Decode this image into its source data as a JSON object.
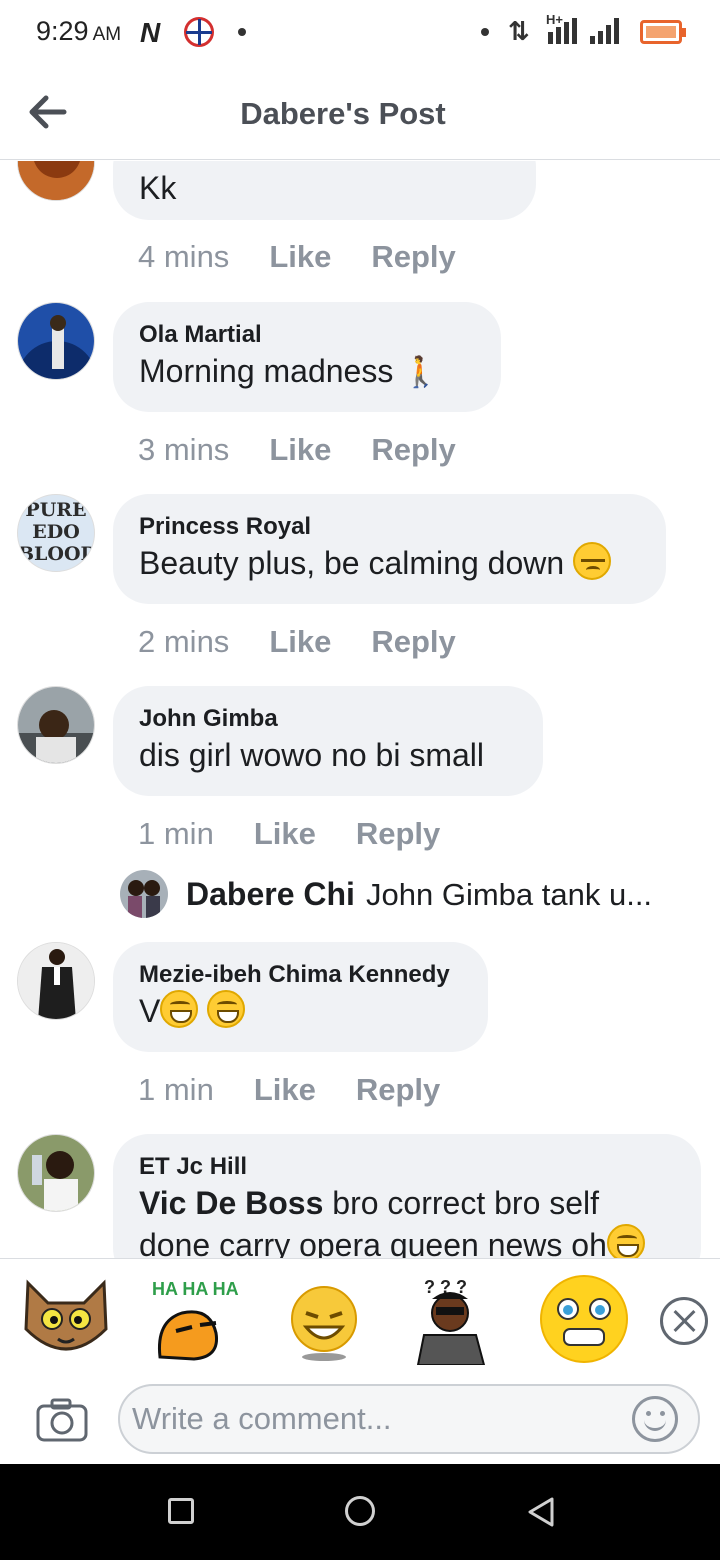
{
  "status_bar": {
    "time": "9:29",
    "ampm": "AM",
    "network_label": "H+"
  },
  "header": {
    "title": "Dabere's Post"
  },
  "comments": [
    {
      "author": "",
      "text": "Kk",
      "time": "4 mins",
      "like": "Like",
      "reply": "Reply"
    },
    {
      "author": "Ola Martial",
      "text": "Morning madness",
      "time": "3 mins",
      "like": "Like",
      "reply": "Reply"
    },
    {
      "author": "Princess Royal",
      "text": "Beauty plus, be calming down",
      "time": "2 mins",
      "like": "Like",
      "reply": "Reply",
      "avatar_text": [
        "PURE",
        "EDO",
        "BLOOD"
      ]
    },
    {
      "author": "John Gimba",
      "text": "dis  girl wowo no bi small",
      "time": "1 min",
      "like": "Like",
      "reply": "Reply"
    },
    {
      "author": "Mezie-ibeh Chima Kennedy",
      "text": "V",
      "time": "1 min",
      "like": "Like",
      "reply": "Reply"
    },
    {
      "author": "ET Jc Hill",
      "mention": "Vic De Boss",
      "text": " bro correct bro self",
      "text_line2": "done carry opera queen news oh"
    }
  ],
  "reply_preview": {
    "author": "Dabere Chi",
    "text": "John Gimba tank u..."
  },
  "stickers": [
    {
      "name": "cat-sticker"
    },
    {
      "name": "haha-sticker",
      "text": "HA HA HA"
    },
    {
      "name": "laughing-face-sticker"
    },
    {
      "name": "confused-man-sticker",
      "text": "? ? ?"
    },
    {
      "name": "shocked-face-sticker"
    }
  ],
  "composer": {
    "placeholder": "Write a comment..."
  },
  "colors": {
    "bubble": "#f0f2f5",
    "meta_text": "#8d949e",
    "header_text": "#4b4f56",
    "battery": "#e8642c"
  }
}
